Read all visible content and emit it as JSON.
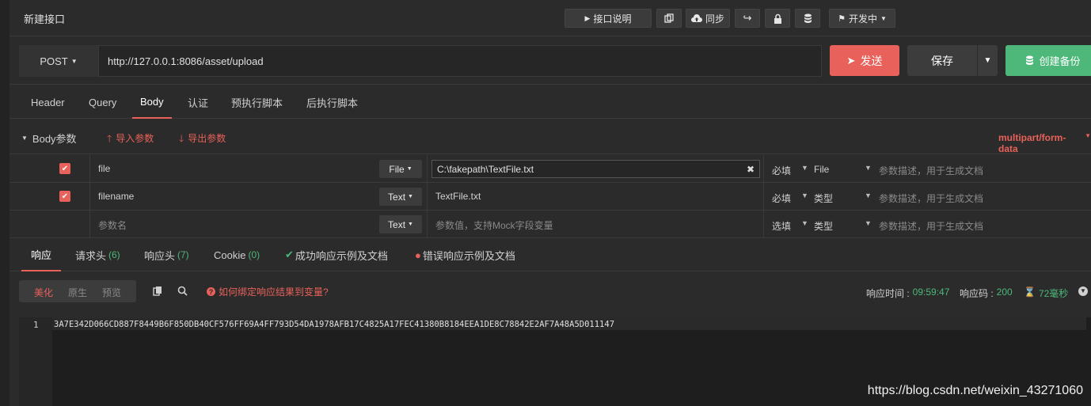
{
  "header": {
    "title": "新建接口",
    "buttons": {
      "doc": "接口说明",
      "sync": "同步",
      "status": "开发中"
    }
  },
  "request": {
    "method": "POST",
    "url": "http://127.0.0.1:8086/asset/upload",
    "send_label": "发送",
    "save_label": "保存",
    "backup_label": "创建备份"
  },
  "request_tabs": [
    "Header",
    "Query",
    "Body",
    "认证",
    "预执行脚本",
    "后执行脚本"
  ],
  "body_params": {
    "title": "Body参数",
    "import_label": "导入参数",
    "export_label": "导出参数",
    "content_type": "multipart/form-data",
    "rows": [
      {
        "checked": true,
        "name": "file",
        "type": "File",
        "value": "C:\\fakepath\\TextFile.txt",
        "required": "必填",
        "field_type": "File",
        "desc_placeholder": "参数描述，用于生成文档"
      },
      {
        "checked": true,
        "name": "filename",
        "type": "Text",
        "value": "TextFile.txt",
        "required": "必填",
        "field_type": "类型",
        "desc_placeholder": "参数描述，用于生成文档"
      },
      {
        "checked": false,
        "name_placeholder": "参数名",
        "type": "Text",
        "value_placeholder": "参数值，支持Mock字段变量",
        "required": "选填",
        "field_type": "类型",
        "desc_placeholder": "参数描述，用于生成文档"
      }
    ]
  },
  "response_tabs": {
    "response": "响应",
    "req_headers": "请求头",
    "req_headers_count": "(6)",
    "resp_headers": "响应头",
    "resp_headers_count": "(7)",
    "cookie": "Cookie",
    "cookie_count": "(0)",
    "success_example": "成功响应示例及文档",
    "error_example": "错误响应示例及文档"
  },
  "response_toolbar": {
    "view_modes": [
      "美化",
      "原生",
      "预览"
    ],
    "help_link": "如何绑定响应结果到变量?",
    "time_label": "响应时间 :",
    "time_value": "09:59:47",
    "code_label": "响应码 :",
    "code_value": "200",
    "duration": "72毫秒"
  },
  "response_body": {
    "line_number": "1",
    "text": "3A7E342D066CD887F8449B6F850DB40CF576FF69A4FF793D54DA1978AFB17C4825A17FEC41380B8184EEA1DE8C78842E2AF7A48A5D011147"
  },
  "watermark": "https://blog.csdn.net/weixin_43271060",
  "colors": {
    "accent": "#e8615a",
    "success": "#4db87a",
    "background": "#2b2b2b"
  }
}
